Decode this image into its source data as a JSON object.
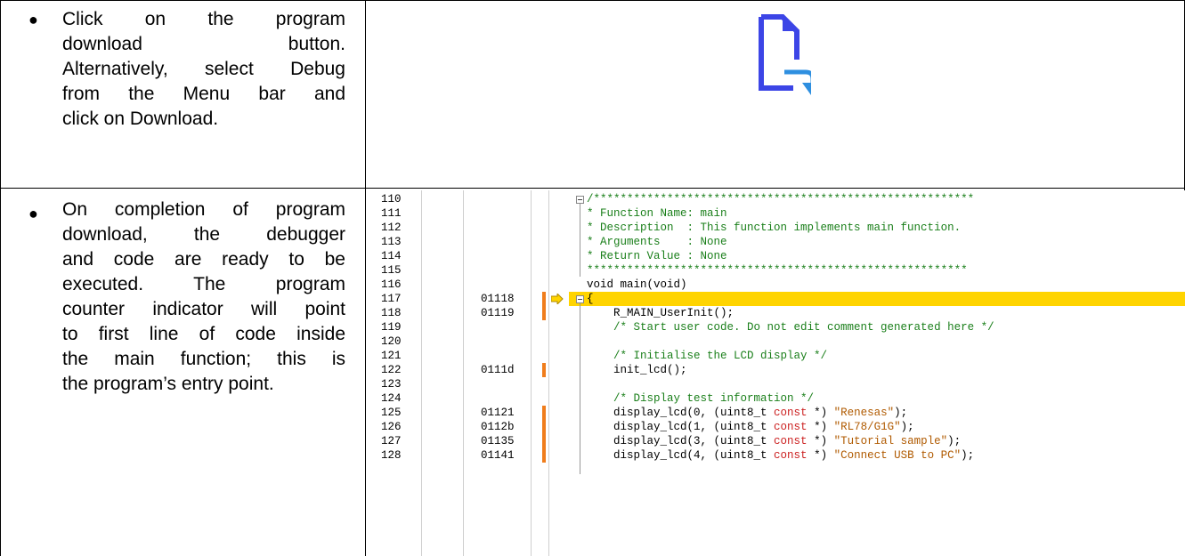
{
  "rows": [
    {
      "instruction_lines": [
        "Click on the program",
        "download button.",
        "Alternatively, select Debug",
        "from the Menu bar and",
        "click on Download."
      ],
      "icon": "download-file-icon",
      "icon_colors": {
        "page": "#3c45e6",
        "arrow": "#2e8fe0"
      }
    },
    {
      "instruction_lines": [
        "On completion of program",
        "download, the debugger",
        "and code are ready to be",
        "executed. The program",
        "counter indicator will point",
        "to first line of code inside",
        "the main function; this is",
        "the program’s entry point."
      ]
    }
  ],
  "code_view": {
    "lines": [
      {
        "num": "110",
        "addr": "",
        "code": "/*********************************************************",
        "kind": "cmt"
      },
      {
        "num": "111",
        "addr": "",
        "code": "* Function Name: main",
        "kind": "cmt"
      },
      {
        "num": "112",
        "addr": "",
        "code": "* Description  : This function implements main function.",
        "kind": "cmt"
      },
      {
        "num": "113",
        "addr": "",
        "code": "* Arguments    : None",
        "kind": "cmt"
      },
      {
        "num": "114",
        "addr": "",
        "code": "* Return Value : None",
        "kind": "cmt"
      },
      {
        "num": "115",
        "addr": "",
        "code": "*********************************************************",
        "kind": "cmt"
      },
      {
        "num": "116",
        "addr": "",
        "code": "void main(void)",
        "kind": "plain"
      },
      {
        "num": "117",
        "addr": "01118",
        "code": "{",
        "kind": "plain"
      },
      {
        "num": "118",
        "addr": "01119",
        "code": "    R_MAIN_UserInit();",
        "kind": "plain"
      },
      {
        "num": "119",
        "addr": "",
        "code": "    /* Start user code. Do not edit comment generated here */",
        "kind": "cmt"
      },
      {
        "num": "120",
        "addr": "",
        "code": "",
        "kind": "plain"
      },
      {
        "num": "121",
        "addr": "",
        "code": "    /* Initialise the LCD display */",
        "kind": "cmt"
      },
      {
        "num": "122",
        "addr": "0111d",
        "code": "    init_lcd();",
        "kind": "plain"
      },
      {
        "num": "123",
        "addr": "",
        "code": "",
        "kind": "plain"
      },
      {
        "num": "124",
        "addr": "",
        "code": "    /* Display test information */",
        "kind": "cmt"
      },
      {
        "num": "125",
        "addr": "01121",
        "code": "    display_lcd(0, (uint8_t ",
        "kw": "const",
        "code2": " *) ",
        "str": "\"Renesas\"",
        "code3": ");",
        "kind": "call"
      },
      {
        "num": "126",
        "addr": "0112b",
        "code": "    display_lcd(1, (uint8_t ",
        "kw": "const",
        "code2": " *) ",
        "str": "\"RL78/G1G\"",
        "code3": ");",
        "kind": "call"
      },
      {
        "num": "127",
        "addr": "01135",
        "code": "    display_lcd(3, (uint8_t ",
        "kw": "const",
        "code2": " *) ",
        "str": "\"Tutorial sample\"",
        "code3": ");",
        "kind": "call"
      },
      {
        "num": "128",
        "addr": "01141",
        "code": "    display_lcd(4, (uint8_t ",
        "kw": "const",
        "code2": " *) ",
        "str": "\"Connect USB to PC\"",
        "code3": ");",
        "kind": "call"
      }
    ],
    "current_line": "117",
    "breakpoint_lines": [
      "117",
      "118",
      "122",
      "125",
      "126",
      "127",
      "128"
    ],
    "highlight_color": "#ffd400",
    "pc_icon": "program-counter-arrow-icon"
  }
}
